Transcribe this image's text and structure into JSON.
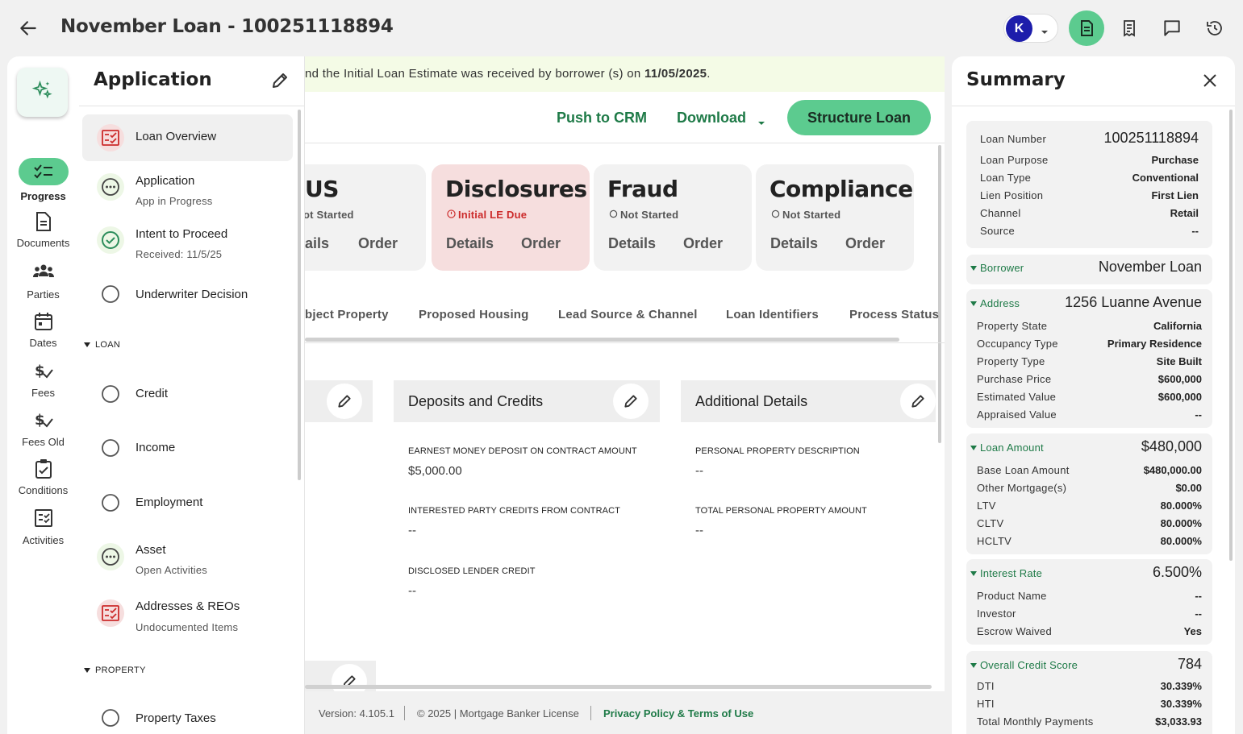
{
  "header": {
    "title": "November Loan - 100251118894",
    "avatar_letter": "K"
  },
  "rail": {
    "items": [
      {
        "label": "Progress"
      },
      {
        "label": "Documents"
      },
      {
        "label": "Parties"
      },
      {
        "label": "Dates"
      },
      {
        "label": "Fees"
      },
      {
        "label": "Fees Old"
      },
      {
        "label": "Conditions"
      },
      {
        "label": "Activities"
      }
    ]
  },
  "app_panel": {
    "title": "Application",
    "steps": [
      {
        "title": "Loan Overview",
        "sub": ""
      },
      {
        "title": "Application",
        "sub": "App in Progress"
      },
      {
        "title": "Intent to Proceed",
        "sub": "Received: 11/5/25"
      },
      {
        "title": "Underwriter Decision",
        "sub": ""
      }
    ],
    "loan_section": "LOAN",
    "loan_steps": [
      {
        "title": "Credit",
        "sub": ""
      },
      {
        "title": "Income",
        "sub": ""
      },
      {
        "title": "Employment",
        "sub": ""
      },
      {
        "title": "Asset",
        "sub": "Open Activities"
      },
      {
        "title": "Addresses & REOs",
        "sub": "Undocumented Items"
      }
    ],
    "property_section": "PROPERTY",
    "property_steps": [
      {
        "title": "Property Taxes",
        "sub": ""
      }
    ]
  },
  "main": {
    "banner_text": "nd the Initial Loan Estimate was received by borrower (s) on ",
    "banner_date": "11/05/2025",
    "banner_end": ".",
    "push_crm": "Push to CRM",
    "download": "Download",
    "structure_loan": "Structure Loan",
    "cards": [
      {
        "title": "US",
        "status": "ot Started",
        "details": "ails",
        "order": "Order"
      },
      {
        "title": "Disclosures",
        "status": "Initial LE Due",
        "details": "Details",
        "order": "Order"
      },
      {
        "title": "Fraud",
        "status": "Not Started",
        "details": "Details",
        "order": "Order"
      },
      {
        "title": "Compliance",
        "status": "Not Started",
        "details": "Details",
        "order": "Order"
      }
    ],
    "tabs": [
      "bject Property",
      "Proposed Housing",
      "Lead Source & Channel",
      "Loan Identifiers",
      "Process Status"
    ],
    "sections": {
      "deposits_title": "Deposits and Credits",
      "additional_title": "Additional Details"
    },
    "fields": {
      "earnest_label": "EARNEST MONEY DEPOSIT ON CONTRACT AMOUNT",
      "earnest_value": "$5,000.00",
      "interested_label": "INTERESTED PARTY CREDITS FROM CONTRACT",
      "interested_value": "--",
      "lender_credit_label": "DISCLOSED LENDER CREDIT",
      "lender_credit_value": "--",
      "personal_desc_label": "PERSONAL PROPERTY DESCRIPTION",
      "personal_desc_value": "--",
      "personal_total_label": "TOTAL PERSONAL PROPERTY AMOUNT",
      "personal_total_value": "--"
    }
  },
  "footer": {
    "version": "Version: 4.105.1",
    "copyright": "© 2025 | Mortgage Banker License",
    "privacy": "Privacy Policy & Terms of Use"
  },
  "summary": {
    "title": "Summary",
    "loan_info": [
      {
        "k": "Loan Number",
        "v": "100251118894"
      },
      {
        "k": "Loan Purpose",
        "v": "Purchase"
      },
      {
        "k": "Loan Type",
        "v": "Conventional"
      },
      {
        "k": "Lien Position",
        "v": "First Lien"
      },
      {
        "k": "Channel",
        "v": "Retail"
      },
      {
        "k": "Source",
        "v": "--"
      }
    ],
    "borrower": {
      "k": "Borrower",
      "v": "November Loan"
    },
    "address": {
      "k": "Address",
      "v": "1256 Luanne Avenue"
    },
    "address_rows": [
      {
        "k": "Property State",
        "v": "California"
      },
      {
        "k": "Occupancy Type",
        "v": "Primary Residence"
      },
      {
        "k": "Property Type",
        "v": "Site Built"
      },
      {
        "k": "Purchase Price",
        "v": "$600,000"
      },
      {
        "k": "Estimated Value",
        "v": "$600,000"
      },
      {
        "k": "Appraised Value",
        "v": "--"
      }
    ],
    "loan_amount": {
      "k": "Loan Amount",
      "v": "$480,000"
    },
    "loan_amount_rows": [
      {
        "k": "Base Loan Amount",
        "v": "$480,000.00"
      },
      {
        "k": "Other Mortgage(s)",
        "v": "$0.00"
      },
      {
        "k": "LTV",
        "v": "80.000%"
      },
      {
        "k": "CLTV",
        "v": "80.000%"
      },
      {
        "k": "HCLTV",
        "v": "80.000%"
      }
    ],
    "interest_rate": {
      "k": "Interest Rate",
      "v": "6.500%"
    },
    "interest_rows": [
      {
        "k": "Product Name",
        "v": "--"
      },
      {
        "k": "Investor",
        "v": "--"
      },
      {
        "k": "Escrow Waived",
        "v": "Yes"
      }
    ],
    "credit_score": {
      "k": "Overall Credit Score",
      "v": "784"
    },
    "credit_rows": [
      {
        "k": "DTI",
        "v": "30.339%"
      },
      {
        "k": "HTI",
        "v": "30.339%"
      },
      {
        "k": "Total Monthly Payments",
        "v": "$3,033.93"
      }
    ]
  }
}
